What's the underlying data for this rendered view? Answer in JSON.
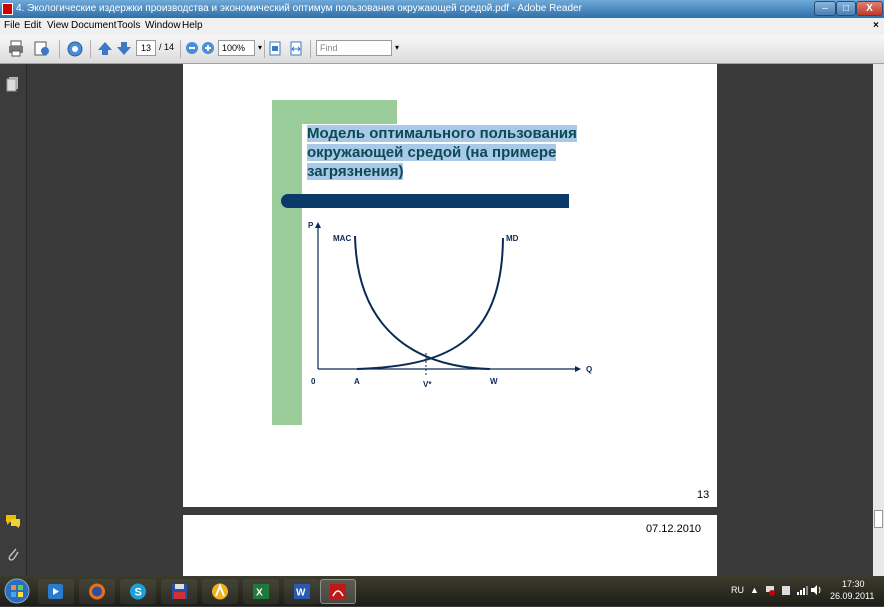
{
  "window": {
    "title": "4. Экологические издержки производства и экономический оптимум пользования окружающей средой.pdf - Adobe Reader",
    "minimize": "–",
    "maximize": "□",
    "close": "X",
    "close_doc": "×"
  },
  "menu": [
    "File",
    "Edit",
    "View",
    "Document",
    "Tools",
    "Window",
    "Help"
  ],
  "toolbar": {
    "page_current": "13",
    "page_total": "/ 14",
    "zoom": "100%",
    "find_placeholder": "Find"
  },
  "slide": {
    "heading_lines": [
      "Модель оптимального пользования",
      "окружающей средой (на примере",
      "загрязнения)"
    ],
    "page_number": "13",
    "date": "07.12.2010"
  },
  "chart_data": {
    "type": "line",
    "title": "",
    "ylabel": "P",
    "xlabel": "Q",
    "origin_label": "0",
    "x_point_labels": [
      "A",
      "V*",
      "W"
    ],
    "series": [
      {
        "name": "MAC",
        "shape": "decreasing convex curve from top-left, reaching zero at W"
      },
      {
        "name": "MD",
        "shape": "increasing convex curve from A rising to top-right"
      }
    ],
    "intersection_label": "V*",
    "colors": {
      "curves": "#0b2a55",
      "axes": "#0b2a55"
    }
  },
  "taskbar": {
    "lang": "RU",
    "time": "17:30",
    "date": "26.09.2011"
  },
  "colors": {
    "accent_green": "#99cc99",
    "heading_text": "#0b4a52",
    "heading_highlight": "#a9c9e8",
    "bar": "#0b3a6a"
  }
}
